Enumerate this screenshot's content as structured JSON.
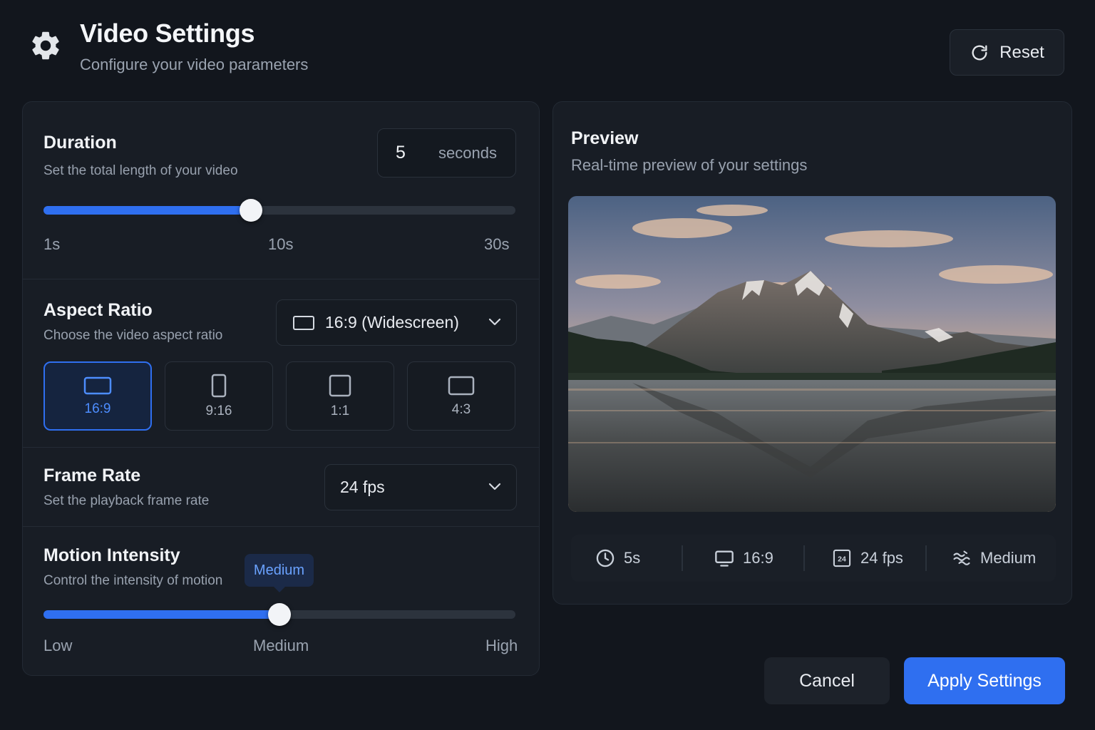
{
  "header": {
    "title": "Video Settings",
    "subtitle": "Configure your video parameters",
    "icon": "gear-icon",
    "reset_label": "Reset"
  },
  "duration": {
    "title": "Duration",
    "subtitle": "Set the total length of your video",
    "value": "5",
    "unit": "seconds",
    "slider_fraction": 0.44,
    "ticks": [
      "1s",
      "10s",
      "30s"
    ]
  },
  "aspect": {
    "title": "Aspect Ratio",
    "subtitle": "Choose the video aspect ratio",
    "selected": "16:9 (Widescreen)",
    "options": [
      {
        "label": "16:9",
        "active": true
      },
      {
        "label": "9:16",
        "active": false
      },
      {
        "label": "1:1",
        "active": false
      },
      {
        "label": "4:3",
        "active": false
      }
    ]
  },
  "frame_rate": {
    "title": "Frame Rate",
    "subtitle": "Set the playback frame rate",
    "selected": "24 fps"
  },
  "motion": {
    "title": "Motion Intensity",
    "subtitle": "Control the intensity of motion",
    "tooltip": "Medium",
    "slider_fraction": 0.5,
    "ticks": [
      "Low",
      "Medium",
      "High"
    ]
  },
  "preview": {
    "title": "Preview",
    "subtitle": "Real-time preview of your settings",
    "stats": [
      {
        "icon": "clock-icon",
        "label": "5s"
      },
      {
        "icon": "monitor-icon",
        "label": "16:9"
      },
      {
        "icon": "fps-icon",
        "label": "24 fps",
        "badge": "24"
      },
      {
        "icon": "motion-icon",
        "label": "Medium"
      }
    ]
  },
  "footer": {
    "cancel_label": "Cancel",
    "apply_label": "Apply Settings"
  },
  "colors": {
    "accent": "#2f6ff0",
    "background": "#12161d",
    "panel": "#181d25"
  }
}
